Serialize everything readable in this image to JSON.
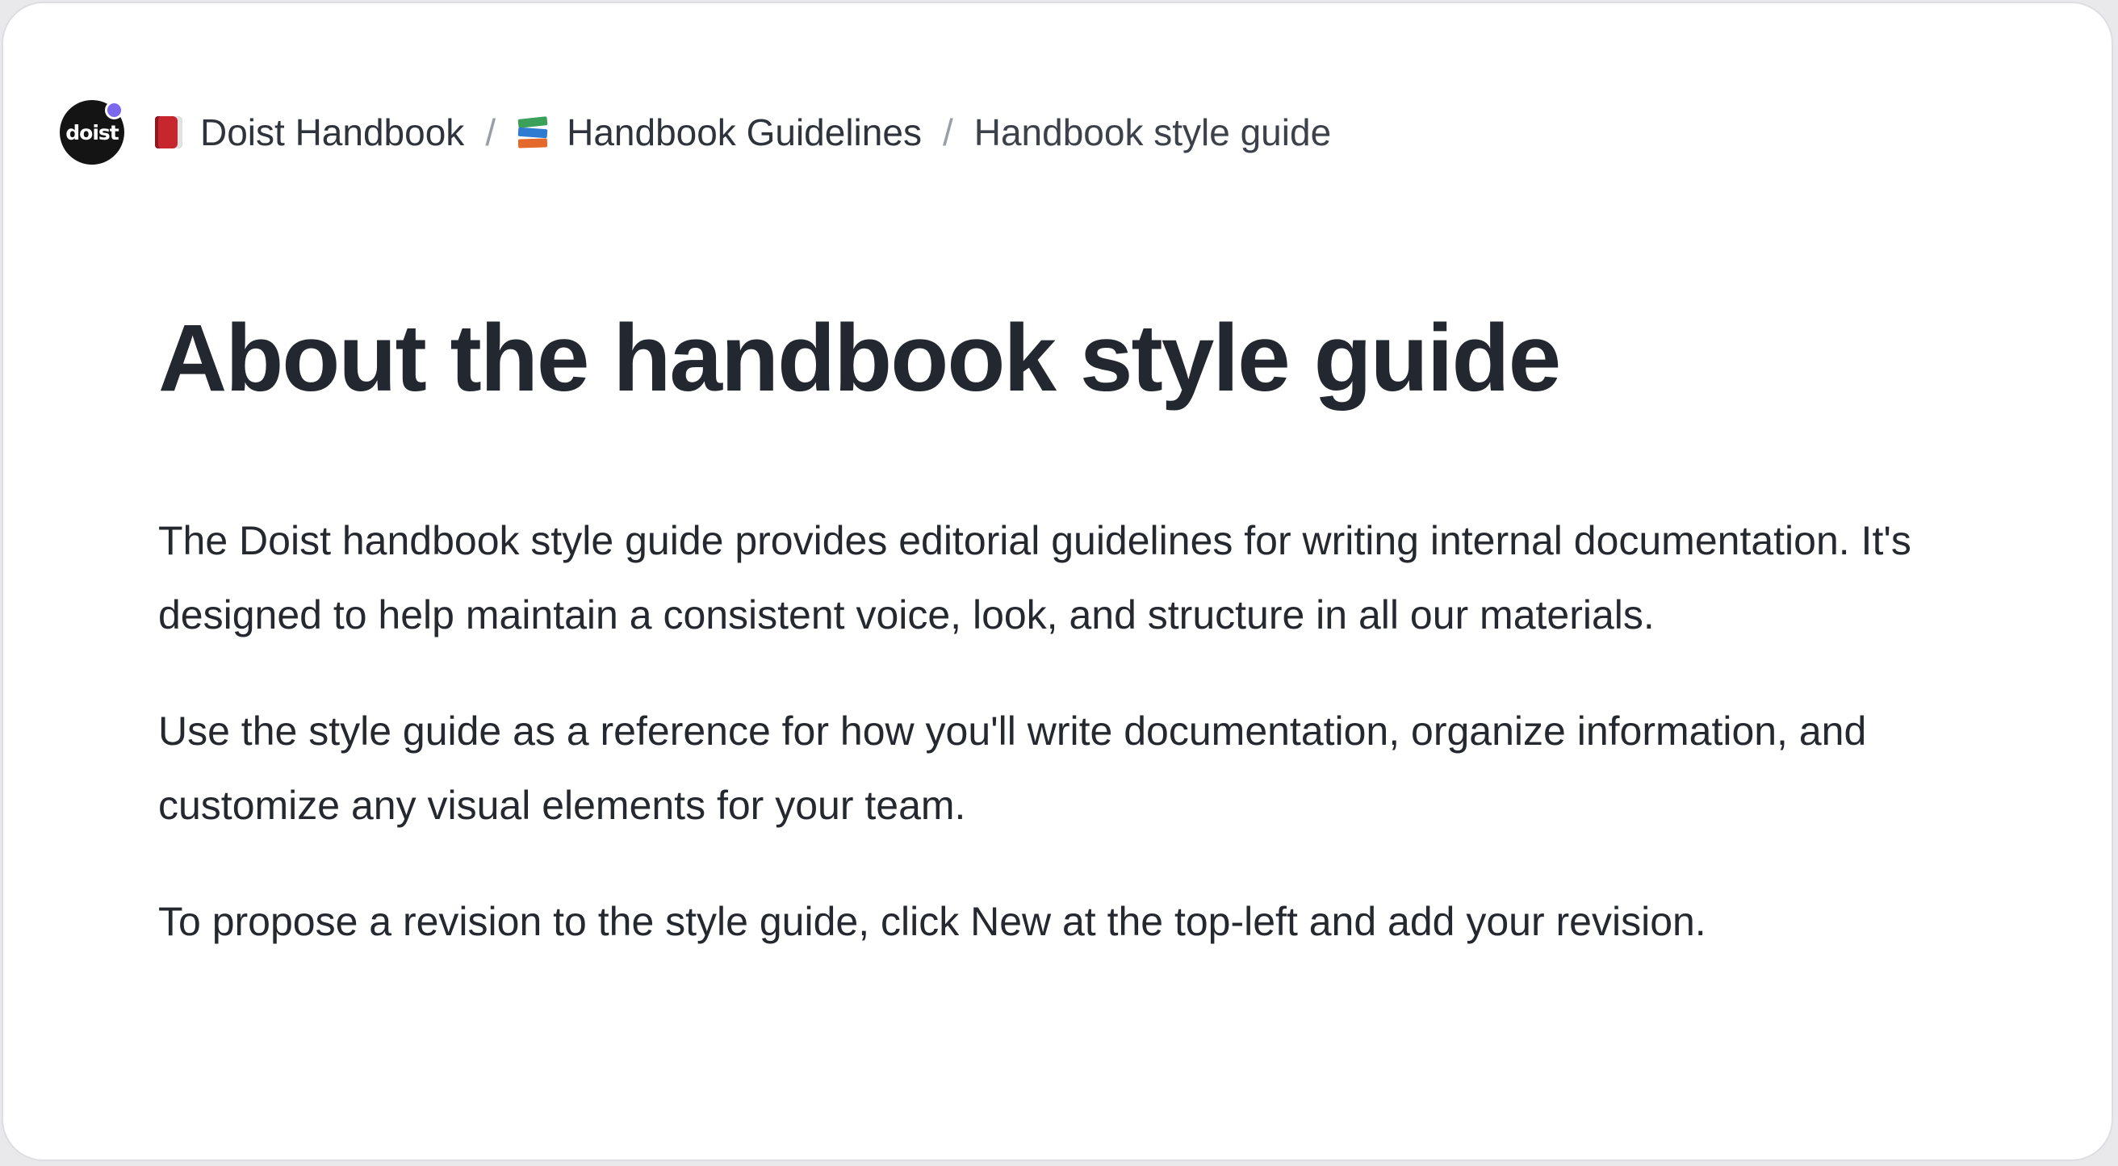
{
  "breadcrumb": {
    "logo_text": "doist",
    "items": [
      {
        "icon": "red-book-icon",
        "label": "Doist Handbook"
      },
      {
        "icon": "books-icon",
        "label": "Handbook Guidelines"
      }
    ],
    "separator": "/",
    "current": "Handbook style guide"
  },
  "page": {
    "title": "About the handbook style guide",
    "paragraphs": [
      "The Doist handbook style guide provides editorial guidelines for writing internal documentation. It's designed to help maintain a consistent voice, look, and structure in all our materials.",
      "Use the style guide as a reference for how you'll write documentation, organize information, and customize any visual elements for your team.",
      "To propose a revision to the style guide, click New at the top-left and add your revision."
    ]
  },
  "colors": {
    "logo_bg": "#141414",
    "logo_dot": "#7b68ee",
    "title": "#23272f",
    "body_text": "#25282e",
    "separator": "#9a9ea6"
  }
}
